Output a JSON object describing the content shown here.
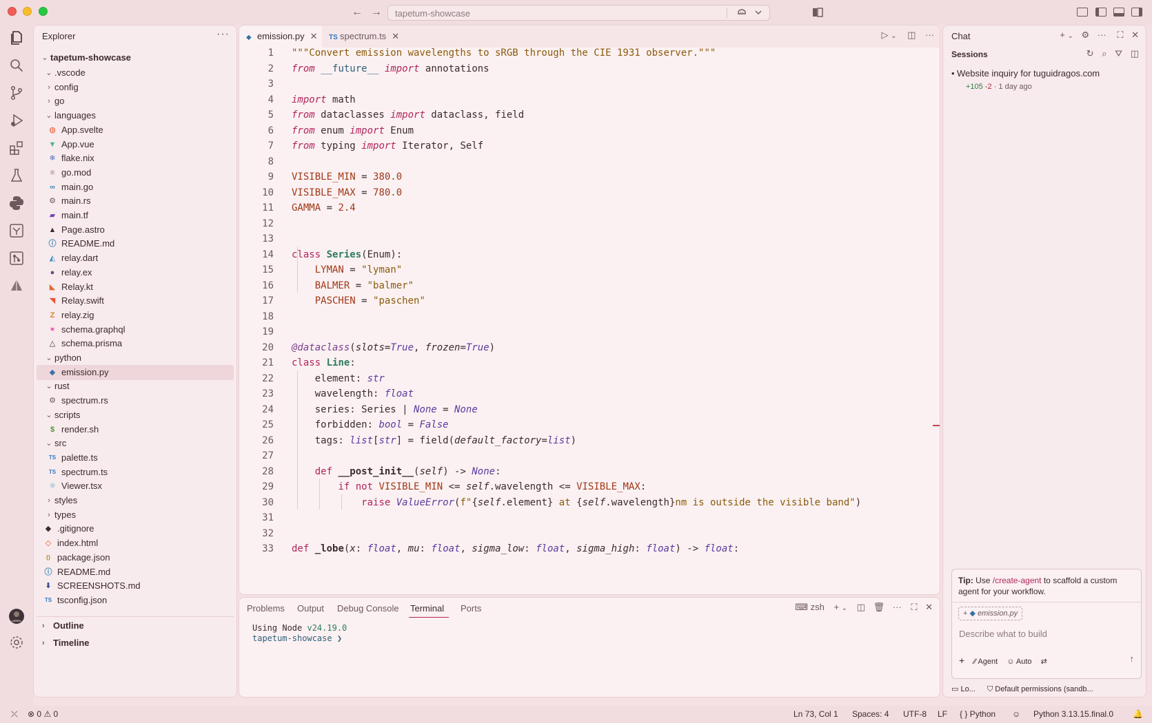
{
  "titlebar": {
    "search_label": "tapetum-showcase",
    "back_label": "←",
    "forward_label": "→"
  },
  "activity_bar": {
    "items": [
      "explorer-icon",
      "search-icon",
      "source-control-icon",
      "run-debug-icon",
      "extensions-icon",
      "testing-icon",
      "python-icon",
      "remote-icon",
      "git-graph-icon",
      "shape-icon"
    ],
    "bottom": [
      "account-icon",
      "settings-gear-icon"
    ]
  },
  "explorer": {
    "title": "Explorer",
    "more": "···",
    "root": "tapetum-showcase",
    "tree": [
      {
        "name": ".vscode",
        "type": "folder",
        "open": true,
        "depth": 1
      },
      {
        "name": "config",
        "type": "folder",
        "open": false,
        "depth": 1
      },
      {
        "name": "go",
        "type": "folder",
        "open": false,
        "depth": 1
      },
      {
        "name": "languages",
        "type": "folder",
        "open": true,
        "depth": 1
      },
      {
        "name": "App.svelte",
        "type": "file",
        "icon": "svelte",
        "depth": 2
      },
      {
        "name": "App.vue",
        "type": "file",
        "icon": "vue",
        "depth": 2
      },
      {
        "name": "flake.nix",
        "type": "file",
        "icon": "nix",
        "depth": 2
      },
      {
        "name": "go.mod",
        "type": "file",
        "icon": "text",
        "depth": 2
      },
      {
        "name": "main.go",
        "type": "file",
        "icon": "go",
        "depth": 2
      },
      {
        "name": "main.rs",
        "type": "file",
        "icon": "rust",
        "depth": 2
      },
      {
        "name": "main.tf",
        "type": "file",
        "icon": "terraform",
        "depth": 2
      },
      {
        "name": "Page.astro",
        "type": "file",
        "icon": "astro",
        "depth": 2
      },
      {
        "name": "README.md",
        "type": "file",
        "icon": "info",
        "depth": 2
      },
      {
        "name": "relay.dart",
        "type": "file",
        "icon": "dart",
        "depth": 2
      },
      {
        "name": "relay.ex",
        "type": "file",
        "icon": "elixir",
        "depth": 2
      },
      {
        "name": "Relay.kt",
        "type": "file",
        "icon": "kotlin",
        "depth": 2
      },
      {
        "name": "Relay.swift",
        "type": "file",
        "icon": "swift",
        "depth": 2
      },
      {
        "name": "relay.zig",
        "type": "file",
        "icon": "zig",
        "depth": 2
      },
      {
        "name": "schema.graphql",
        "type": "file",
        "icon": "graphql",
        "depth": 2
      },
      {
        "name": "schema.prisma",
        "type": "file",
        "icon": "prisma",
        "depth": 2
      },
      {
        "name": "python",
        "type": "folder",
        "open": true,
        "depth": 1
      },
      {
        "name": "emission.py",
        "type": "file",
        "icon": "python",
        "depth": 2,
        "selected": true
      },
      {
        "name": "rust",
        "type": "folder",
        "open": true,
        "depth": 1
      },
      {
        "name": "spectrum.rs",
        "type": "file",
        "icon": "rust",
        "depth": 2
      },
      {
        "name": "scripts",
        "type": "folder",
        "open": true,
        "depth": 1
      },
      {
        "name": "render.sh",
        "type": "file",
        "icon": "shell",
        "depth": 2
      },
      {
        "name": "src",
        "type": "folder",
        "open": true,
        "depth": 1
      },
      {
        "name": "palette.ts",
        "type": "file",
        "icon": "ts",
        "depth": 2
      },
      {
        "name": "spectrum.ts",
        "type": "file",
        "icon": "ts",
        "depth": 2
      },
      {
        "name": "Viewer.tsx",
        "type": "file",
        "icon": "react",
        "depth": 2
      },
      {
        "name": "styles",
        "type": "folder",
        "open": false,
        "depth": 1
      },
      {
        "name": "types",
        "type": "folder",
        "open": false,
        "depth": 1
      },
      {
        "name": ".gitignore",
        "type": "file",
        "icon": "git",
        "depth": 1
      },
      {
        "name": "index.html",
        "type": "file",
        "icon": "html",
        "depth": 1
      },
      {
        "name": "package.json",
        "type": "file",
        "icon": "json",
        "depth": 1
      },
      {
        "name": "README.md",
        "type": "file",
        "icon": "markdown",
        "depth": 1
      },
      {
        "name": "SCREENSHOTS.md",
        "type": "file",
        "icon": "markdown-dl",
        "depth": 1
      },
      {
        "name": "tsconfig.json",
        "type": "file",
        "icon": "tsconfig",
        "depth": 1
      }
    ],
    "outline_label": "Outline",
    "timeline_label": "Timeline"
  },
  "editor": {
    "tabs": [
      {
        "label": "emission.py",
        "icon": "python",
        "active": true
      },
      {
        "label": "spectrum.ts",
        "icon": "ts",
        "active": false
      }
    ],
    "code_lines": [
      "<span class=\"s\">\"\"\"Convert emission wavelengths to sRGB through the CIE 1931 observer.\"\"\"</span>",
      "<span class=\"k\">from</span> <span class=\"mod\">__future__</span> <span class=\"k\">import</span> annotations",
      "",
      "<span class=\"k\">import</span> math",
      "<span class=\"k\">from</span> dataclasses <span class=\"k\">import</span> dataclass, field",
      "<span class=\"k\">from</span> enum <span class=\"k\">import</span> Enum",
      "<span class=\"k\">from</span> typing <span class=\"k\">import</span> Iterator, Self",
      "",
      "<span class=\"cst\">VISIBLE_MIN</span> = <span class=\"n\">380.0</span>",
      "<span class=\"cst\">VISIBLE_MAX</span> = <span class=\"n\">780.0</span>",
      "<span class=\"cst\">GAMMA</span> = <span class=\"n\">2.4</span>",
      "",
      "",
      "<span class=\"kw\">class</span> <span class=\"cl\">Series</span>(Enum):",
      "    <span class=\"cst\">LYMAN</span> = <span class=\"s\">\"lyman\"</span>",
      "    <span class=\"cst\">BALMER</span> = <span class=\"s\">\"balmer\"</span>",
      "    <span class=\"cst\">PASCHEN</span> = <span class=\"s\">\"paschen\"</span>",
      "",
      "",
      "<span class=\"dec\">@dataclass</span>(<span class=\"prm\">slots</span>=<span class=\"t\">True</span>, <span class=\"prm\">frozen</span>=<span class=\"t\">True</span>)",
      "<span class=\"kw\">class</span> <span class=\"cl\">Line</span>:",
      "    element: <span class=\"t\">str</span>",
      "    wavelength: <span class=\"t\">float</span>",
      "    series: Series | <span class=\"t\">None</span> = <span class=\"t\">None</span>",
      "    forbidden: <span class=\"t\">bool</span> = <span class=\"t\">False</span>",
      "    tags: <span class=\"t\">list</span>[<span class=\"t\">str</span>] = field(<span class=\"prm\">default_factory</span>=<span class=\"t\">list</span>)",
      "",
      "    <span class=\"kw\">def</span> <span class=\"fn\">__post_init__</span>(<span class=\"prm\">self</span>) -&gt; <span class=\"t\">None</span>:",
      "        <span class=\"kw\">if</span> <span class=\"kw\">not</span> <span class=\"cst\">VISIBLE_MIN</span> &lt;= <span class=\"prm\">self</span>.wavelength &lt;= <span class=\"cst\">VISIBLE_MAX</span>:",
      "            <span class=\"kw\">raise</span> <span class=\"t\">ValueError</span>(<span class=\"s\">f\"</span>{<span class=\"prm\">self</span>.element}<span class=\"s\"> at </span>{<span class=\"prm\">self</span>.wavelength}<span class=\"s\">nm is outside the visible band\"</span>)",
      "",
      "",
      "<span class=\"kw\">def</span> <span class=\"fn\">_lobe</span>(<span class=\"prm\">x</span>: <span class=\"t\">float</span>, <span class=\"prm\">mu</span>: <span class=\"t\">float</span>, <span class=\"prm\">sigma_low</span>: <span class=\"t\">float</span>, <span class=\"prm\">sigma_high</span>: <span class=\"t\">float</span>) -&gt; <span class=\"t\">float</span>:"
    ]
  },
  "panel": {
    "tabs": [
      "Problems",
      "Output",
      "Debug Console",
      "Terminal",
      "Ports"
    ],
    "active_tab": "Terminal",
    "shell": "zsh",
    "terminal_line1_prefix": "Using Node ",
    "terminal_line1_version": "v24.19.0",
    "terminal_line2": "tapetum-showcase ❯"
  },
  "chat": {
    "title": "Chat",
    "sessions_label": "Sessions",
    "session_title": "Website inquiry for tuguidragos.com",
    "session_added": "+105",
    "session_removed": "-2",
    "session_time": "· 1 day ago",
    "tip_bold": "Tip:",
    "tip_pre": " Use ",
    "tip_cmd": "/create-agent",
    "tip_post": " to scaffold a custom agent for your workflow.",
    "context_chip": "emission.py",
    "input_placeholder": "Describe what to build",
    "mode_label": "Agent",
    "model_label": "Auto",
    "footer_left": "Lo...",
    "footer_right": "Default permissions (sandb..."
  },
  "statusbar": {
    "errors": "0",
    "warnings": "0",
    "position": "Ln 73, Col 1",
    "spaces": "Spaces: 4",
    "encoding": "UTF-8",
    "eol": "LF",
    "language": "{ } Python",
    "interpreter": "Python 3.13.15.final.0"
  },
  "colors": {
    "background": "#f5e1e4",
    "accent": "#b0245d"
  }
}
